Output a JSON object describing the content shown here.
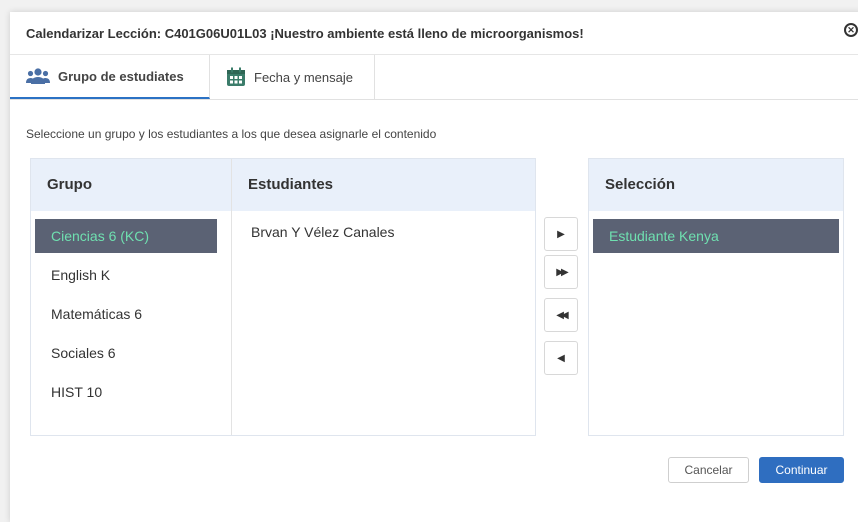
{
  "dialog": {
    "title": "Calendarizar Lección: C401G06U01L03 ¡Nuestro ambiente está lleno de microorganismos!",
    "close_glyph": "✕"
  },
  "tabs": [
    {
      "label": "Grupo de estudiates",
      "icon": "users-icon",
      "active": true
    },
    {
      "label": "Fecha y mensaje",
      "icon": "calendar-icon",
      "active": false
    }
  ],
  "instruction": "Seleccione un grupo y los estudiantes a los que desea asignarle el contenido",
  "columns": {
    "group": "Grupo",
    "students": "Estudiantes",
    "selection": "Selección"
  },
  "groups": [
    {
      "label": "Ciencias 6 (KC)",
      "selected": true
    },
    {
      "label": "English K",
      "selected": false
    },
    {
      "label": "Matemáticas 6",
      "selected": false
    },
    {
      "label": "Sociales 6",
      "selected": false
    },
    {
      "label": "HIST 10",
      "selected": false
    }
  ],
  "students": [
    "Bryan Y Vélez Canales"
  ],
  "selection": [
    "Estudiante Kenya"
  ],
  "transfer_buttons": [
    {
      "glyph": "▶",
      "icon": "move-right-icon"
    },
    {
      "glyph": "▶▶",
      "icon": "move-all-right-icon"
    },
    {
      "glyph": "◀◀",
      "icon": "move-all-left-icon"
    },
    {
      "glyph": "◀",
      "icon": "move-left-icon"
    }
  ],
  "actions": {
    "cancel": "Cancelar",
    "continue": "Continuar"
  },
  "colors": {
    "accent": "#2f6ec0",
    "selected_bg": "#5b6274",
    "selected_text": "#6fe0b0",
    "header_bg": "#e9f0fa"
  }
}
